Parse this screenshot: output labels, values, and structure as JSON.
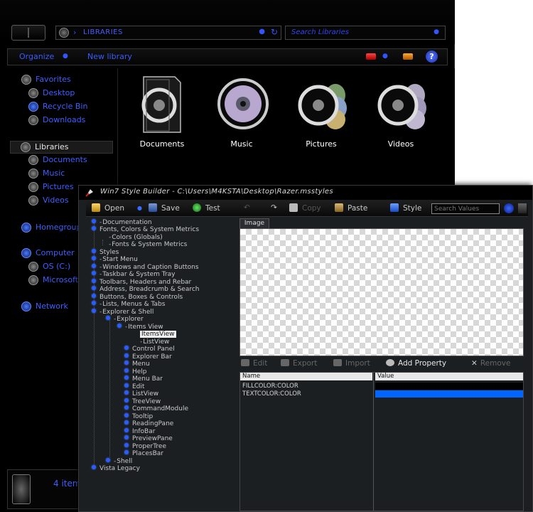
{
  "explorer": {
    "address": {
      "crumb": "LIBRARIES"
    },
    "search_placeholder": "Search Libraries",
    "commands": {
      "organize": "Organize",
      "new_library": "New library"
    },
    "help_glyph": "?",
    "nav": {
      "favorites": "Favorites",
      "desktop": "Desktop",
      "recycle_bin": "Recycle Bin",
      "downloads": "Downloads",
      "libraries": "Libraries",
      "documents": "Documents",
      "music": "Music",
      "pictures": "Pictures",
      "videos": "Videos",
      "homegroup": "Homegroup",
      "computer": "Computer",
      "os_c": "OS (C:)",
      "microsoft": "Microsoft",
      "network": "Network"
    },
    "libraries": [
      {
        "label": "Documents"
      },
      {
        "label": "Music"
      },
      {
        "label": "Pictures"
      },
      {
        "label": "Videos"
      }
    ],
    "status_count": "4 item"
  },
  "builder": {
    "title": "Win7 Style Builder - C:\\Users\\M4KSTA\\Desktop\\Razer.msstyles",
    "toolbar": {
      "open": "Open",
      "save": "Save",
      "test": "Test",
      "copy": "Copy",
      "paste": "Paste",
      "style": "Style",
      "search_placeholder": "Search Values"
    },
    "tree": {
      "documentation": "Documentation",
      "fonts_colors": "Fonts, Colors & System Metrics",
      "colors_globals": "Colors (Globals)",
      "fonts_sysmetrics": "Fonts & System Metrics",
      "styles": "Styles",
      "start_menu": "Start Menu",
      "windows_caption": "Windows and Caption Buttons",
      "taskbar": "Taskbar & System Tray",
      "toolbars": "Toolbars, Headers and Rebar",
      "address": "Address, Breadcrumb & Search",
      "buttons": "Buttons, Boxes & Controls",
      "lists": "Lists, Menus & Tabs",
      "explorer_shell": "Explorer & Shell",
      "explorer": "Explorer",
      "items_view": "Items View",
      "itemsview": "ItemsView",
      "listview": "ListView",
      "control_panel": "Control Panel",
      "explorer_bar": "Explorer Bar",
      "menu": "Menu",
      "help": "Help",
      "menu_bar": "Menu Bar",
      "edit": "Edit",
      "listview2": "ListView",
      "treeview": "TreeView",
      "commandmodule": "CommandModule",
      "tooltip": "Tooltip",
      "readingpane": "ReadingPane",
      "infobar": "InfoBar",
      "previewpane": "PreviewPane",
      "propertree": "ProperTree",
      "placesbar": "PlacesBar",
      "shell": "Shell",
      "vista_legacy": "Vista Legacy"
    },
    "image_tab": "Image",
    "prop_toolbar": {
      "edit": "Edit",
      "export": "Export",
      "import": "Import",
      "add_property": "Add Property",
      "remove": "Remove"
    },
    "grid": {
      "col_name": "Name",
      "col_value": "Value",
      "rows": [
        {
          "name": "FILLCOLOR:COLOR",
          "value_color": "#000000"
        },
        {
          "name": "TEXTCOLOR:COLOR",
          "value_color": "#0066ff"
        }
      ]
    }
  },
  "colors": {
    "accent_blue": "#3f5fff",
    "selection_blue": "#0066ff"
  }
}
